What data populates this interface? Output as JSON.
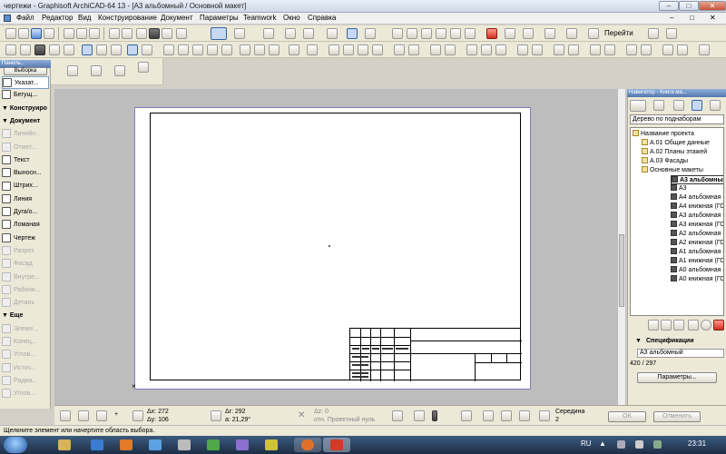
{
  "window": {
    "title": "чертежи - Graphisoft ArchiCAD-64 13 - [A3 альбомный / Основной макет]",
    "minimize": "–",
    "maximize": "□",
    "close": "✕"
  },
  "menu": [
    "Файл",
    "Редактор",
    "Вид",
    "Конструирование",
    "Документ",
    "Параметры",
    "Teamwork",
    "Окно",
    "Справка"
  ],
  "toolbar": {
    "goto_label": "Перейти"
  },
  "toolbox": {
    "title": "Панель...",
    "select_tab": "Выборка",
    "items": [
      {
        "label": "Указат...",
        "state": "active"
      },
      {
        "label": "Бегущ...",
        "state": "normal"
      },
      {
        "label": "Конструиро",
        "state": "header"
      },
      {
        "label": "Документ",
        "state": "header"
      },
      {
        "label": "Линейн...",
        "state": "disabled"
      },
      {
        "label": "Отмет...",
        "state": "disabled"
      },
      {
        "label": "Текст",
        "state": "normal"
      },
      {
        "label": "Выносн...",
        "state": "normal"
      },
      {
        "label": "Штрих...",
        "state": "normal"
      },
      {
        "label": "Линия",
        "state": "normal"
      },
      {
        "label": "Дуга/о...",
        "state": "normal"
      },
      {
        "label": "Ломаная",
        "state": "normal"
      },
      {
        "label": "Чертеж",
        "state": "normal"
      },
      {
        "label": "Разрез",
        "state": "disabled"
      },
      {
        "label": "Фасад",
        "state": "disabled"
      },
      {
        "label": "Внутре...",
        "state": "disabled"
      },
      {
        "label": "Рабочи...",
        "state": "disabled"
      },
      {
        "label": "Деталь",
        "state": "disabled"
      },
      {
        "label": "Еще",
        "state": "header"
      },
      {
        "label": "Элеме...",
        "state": "disabled"
      },
      {
        "label": "Конец...",
        "state": "disabled"
      },
      {
        "label": "Углов...",
        "state": "disabled"
      },
      {
        "label": "Источ...",
        "state": "disabled"
      },
      {
        "label": "Радиа...",
        "state": "disabled"
      },
      {
        "label": "Углов...",
        "state": "disabled"
      }
    ]
  },
  "navigator": {
    "title": "Навигатор - Книга ма...",
    "view_mode": "Дерево по поднаборам",
    "tree": [
      {
        "label": "Название проекта",
        "level": 0,
        "kind": "root"
      },
      {
        "label": "A.01 Общие данные",
        "level": 1,
        "kind": "folder"
      },
      {
        "label": "A.02 Планы этажей",
        "level": 1,
        "kind": "folder"
      },
      {
        "label": "A.03 Фасады",
        "level": 1,
        "kind": "folder"
      },
      {
        "label": "Основные макеты",
        "level": 1,
        "kind": "folder"
      },
      {
        "label": "A3 альбомный",
        "level": 2,
        "kind": "layout",
        "selected": true
      },
      {
        "label": "A3",
        "level": 2,
        "kind": "layout"
      },
      {
        "label": "A4 альбомная (ГС",
        "level": 2,
        "kind": "layout"
      },
      {
        "label": "A4 книжная (ГОС",
        "level": 2,
        "kind": "layout"
      },
      {
        "label": "A3 альбомная (ГС",
        "level": 2,
        "kind": "layout"
      },
      {
        "label": "A3 книжная (ГОС",
        "level": 2,
        "kind": "layout"
      },
      {
        "label": "A2 альбомная (ГС",
        "level": 2,
        "kind": "layout"
      },
      {
        "label": "A2 книжная (ГОС",
        "level": 2,
        "kind": "layout"
      },
      {
        "label": "A1 альбомная (ГС",
        "level": 2,
        "kind": "layout"
      },
      {
        "label": "A1 книжная (ГОС",
        "level": 2,
        "kind": "layout"
      },
      {
        "label": "A0 альбомная (ГС",
        "level": 2,
        "kind": "layout"
      },
      {
        "label": "A0 книжная (ГОС",
        "level": 2,
        "kind": "layout"
      }
    ],
    "specs_header": "Спецификации",
    "spec_name": "A3 альбомный",
    "spec_size": "420 / 297",
    "params_button": "Параметры..."
  },
  "infobox": {
    "dx_label": "Δx: 272",
    "dy_label": "Δy: 106",
    "dr_label": "Δr: 292",
    "angle_label": "a: 21,29°",
    "dz_label": "Δz: 0",
    "ref_label": "отн. Проектный нуль",
    "snap_label": "Середина",
    "snap_value": "2",
    "ok_button": "OK",
    "cancel_button": "Отменить"
  },
  "status": {
    "hint": "Щелкните элемент или начертите область выбора."
  },
  "taskbar": {
    "lang": "RU",
    "time": "23:31"
  }
}
